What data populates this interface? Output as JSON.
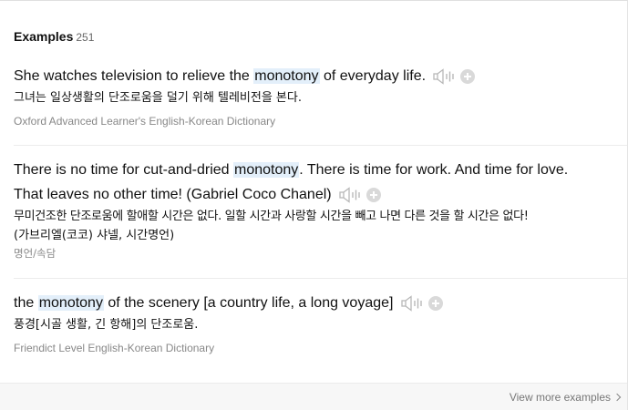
{
  "header": {
    "title": "Examples",
    "count": "251"
  },
  "examples": [
    {
      "line1": {
        "before": "She watches television to relieve the ",
        "keyword": "monotony",
        "after": " of everyday life."
      },
      "translation": "그녀는 일상생활의 단조로움을 덜기 위해 텔레비전을 본다.",
      "source": "Oxford Advanced Learner's English-Korean Dictionary"
    },
    {
      "line1": {
        "before": "There is no time for cut-and-dried ",
        "keyword": "monotony",
        "after": ". There is time for work. And time for love."
      },
      "line2": "That leaves no other time! (Gabriel Coco Chanel)",
      "translation1": "무미건조한 단조로움에 할애할 시간은 없다. 일할 시간과 사랑할 시간을 빼고 나면 다른 것을 할 시간은 없다!",
      "translation2": "(가브리엘(코코) 샤넬, 시간명언)",
      "source": "명언/속담"
    },
    {
      "line1": {
        "before": "the ",
        "keyword": "monotony",
        "after": " of the scenery [a country life, a long voyage]"
      },
      "translation": "풍경[시골 생활, 긴 항해]의 단조로움.",
      "source": "Friendict Level English-Korean Dictionary"
    }
  ],
  "footer": {
    "view_more": "View more examples"
  },
  "icons": {
    "play": "speaker-icon",
    "add": "plus-circle-icon",
    "more": "chevron-right-icon"
  },
  "colors": {
    "highlight": "#e3effa",
    "icon": "#c4c4c4",
    "source_text": "#888888"
  }
}
